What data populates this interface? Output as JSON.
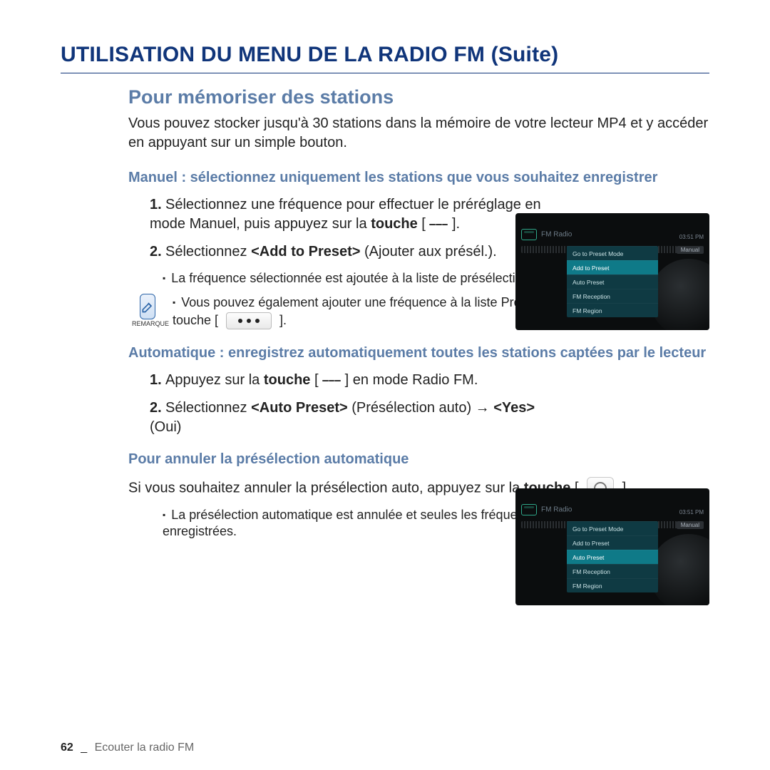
{
  "title": "UTILISATION DU MENU DE LA RADIO FM (Suite)",
  "h2": "Pour mémoriser des stations",
  "intro": "Vous pouvez stocker jusqu'à 30 stations dans la mémoire de votre lecteur MP4 et y accéder en appuyant sur un simple bouton.",
  "manual": {
    "heading": "Manuel : sélectionnez uniquement les stations que vous souhaitez enregistrer",
    "step1_a": "Sélectionnez une fréquence pour effectuer le préréglage en mode Manuel, puis appuyez sur la ",
    "step1_bold": "touche",
    "step1_b": " [ ",
    "step1_c": " ].",
    "step2_a": "Sélectionnez ",
    "step2_bold": "<Add to Preset>",
    "step2_b": " (Ajouter aux présél.).",
    "bullet1": "La fréquence sélectionnée est ajoutée à la liste de présélections."
  },
  "remark": {
    "label": "REMARQUE",
    "text_a": "Vous pouvez également ajouter une fréquence à la liste Présélection en appuyant sur la touche [ ",
    "text_b": " ]."
  },
  "auto": {
    "heading": "Automatique : enregistrez automatiquement toutes les stations captées par le lecteur",
    "step1_a": "Appuyez sur la ",
    "step1_bold": "touche",
    "step1_b": " [ ",
    "step1_c": " ] en mode Radio FM.",
    "step2_a": "Sélectionnez ",
    "step2_bold1": "<Auto Preset>",
    "step2_mid": " (Présélection auto) → ",
    "step2_bold2": "<Yes>",
    "step2_end": " (Oui)"
  },
  "cancel": {
    "heading": "Pour annuler la présélection automatique",
    "text_a": "Si vous souhaitez annuler la présélection auto, appuyez sur la ",
    "text_bold": "touche",
    "text_b": " [ ",
    "text_c": " ].",
    "bullet": "La présélection automatique est annulée et seules les fréquences réglées jusque-là sont enregistrées."
  },
  "footer": {
    "page": "62",
    "sep": "_",
    "chapter": "Ecouter la radio FM"
  },
  "device": {
    "title": "FM Radio",
    "clock": "03:51 PM",
    "mode": "Manual",
    "menu": [
      "Go to Preset Mode",
      "Add to Preset",
      "Auto Preset",
      "FM Reception",
      "FM Region"
    ],
    "selected_fig1": 1,
    "selected_fig2": 2
  }
}
